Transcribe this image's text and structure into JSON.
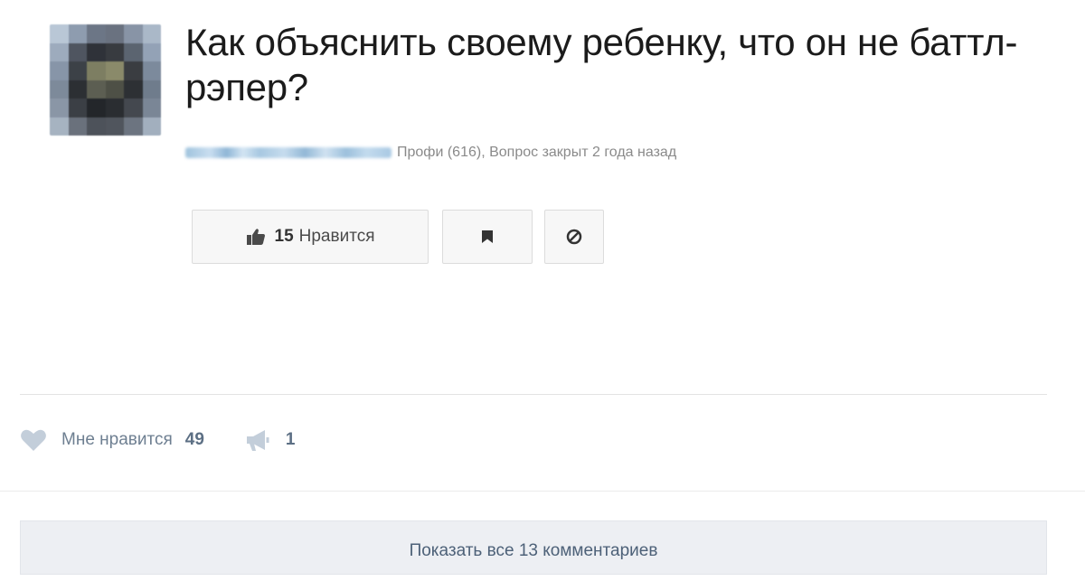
{
  "question": {
    "title": "Как объяснить своему ребенку, что он не баттл-рэпер?",
    "meta": "Профи (616), Вопрос закрыт 2 года назад"
  },
  "buttons": {
    "like_count": "15",
    "like_label": "Нравится",
    "like_icon": "thumbs-up-icon",
    "bookmark_icon": "bookmark-icon",
    "block_icon": "block-icon"
  },
  "post": {
    "like_label": "Мне нравится",
    "like_count": "49",
    "share_count": "1",
    "like_icon": "heart-icon",
    "share_icon": "megaphone-icon"
  },
  "comments": {
    "show_all_label": "Показать все 13 комментариев"
  },
  "colors": {
    "link": "#4d6178",
    "muted_icon": "#c3ceda",
    "button_bg": "#f7f7f7",
    "bar_bg": "#edeff3"
  }
}
